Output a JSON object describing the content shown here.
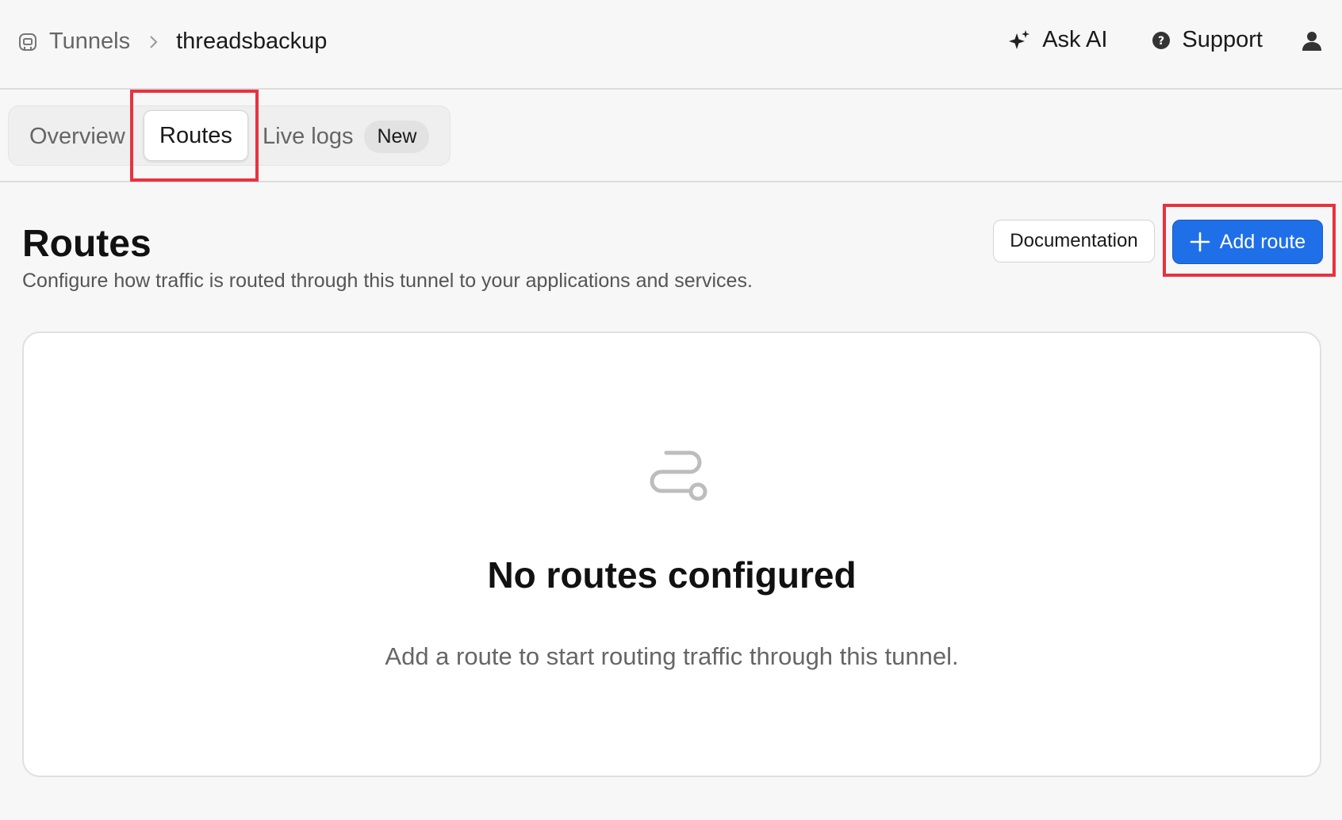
{
  "breadcrumb": {
    "root": "Tunnels",
    "current": "threadsbackup"
  },
  "topbar": {
    "ask_ai": "Ask AI",
    "support": "Support"
  },
  "tabs": {
    "overview": "Overview",
    "routes": "Routes",
    "live_logs": "Live logs",
    "new_badge": "New"
  },
  "header": {
    "title": "Routes",
    "subtitle": "Configure how traffic is routed through this tunnel to your applications and services.",
    "documentation": "Documentation",
    "add_route": "Add route"
  },
  "empty_state": {
    "title": "No routes configured",
    "message": "Add a route to start routing traffic through this tunnel."
  },
  "icons": {
    "tunnel": "tunnel-icon",
    "chevron": "chevron-right-icon",
    "sparkle": "sparkle-icon",
    "help": "help-circle-icon",
    "user": "user-icon",
    "plus": "plus-icon",
    "route": "route-icon"
  },
  "colors": {
    "accent": "#1f6fe8",
    "highlight": "#e8323f"
  }
}
